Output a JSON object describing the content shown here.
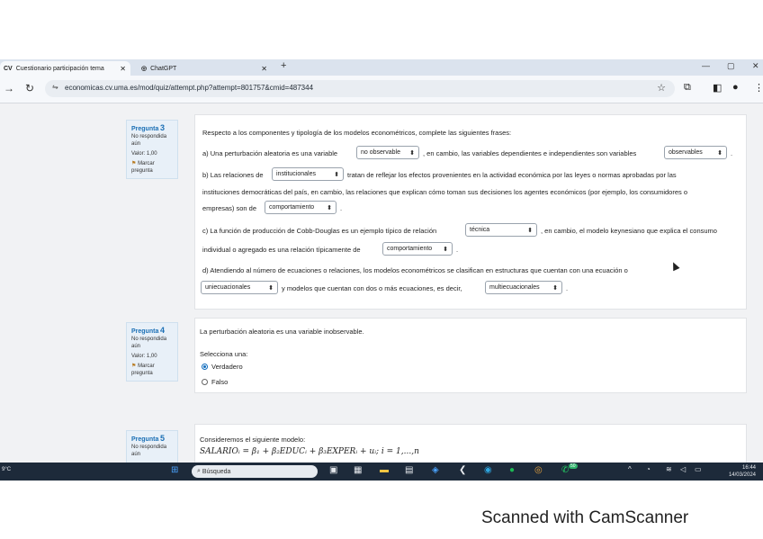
{
  "browser": {
    "tabs": [
      {
        "icon": "CV",
        "label": "Cuestionario participación tema"
      },
      {
        "icon": "◎",
        "label": "ChatGPT"
      }
    ],
    "url": "economicas.cv.uma.es/mod/quiz/attempt.php?attempt=801757&cmid=487344"
  },
  "q3": {
    "title_word": "Pregunta",
    "number": "3",
    "status": "No respondida aún",
    "score": "Valor: 1,00",
    "flag": "Marcar pregunta",
    "intro": "Respecto a los componentes y tipología de los modelos econométricos, complete las siguientes frases:",
    "a1": "a) Una perturbación aleatoria es una variable",
    "a_sel1": "no observable",
    "a2": ", en cambio, las variables dependientes e independientes son variables",
    "a_sel2": "observables",
    "a3": ".",
    "b1": "b) Las relaciones de",
    "b_sel1": "institucionales",
    "b2": "tratan de reflejar los efectos provenientes en la actividad económica por las leyes o normas aprobadas por las",
    "b3": "instituciones democráticas del país, en cambio, las relaciones que explican cómo toman sus decisiones los agentes económicos (por ejemplo, los consumidores o",
    "b4": "empresas) son de",
    "b_sel2": "comportamiento",
    "b5": ".",
    "c1": "c) La función de producción de Cobb-Douglas es un ejemplo típico de relación",
    "c_sel1": "técnica",
    "c2": ", en cambio, el modelo keynesiano que explica el consumo",
    "c3": "individual o agregado es una relación típicamente de",
    "c_sel2": "comportamiento",
    "c4": ".",
    "d1": "d) Atendiendo al número de ecuaciones o relaciones, los modelos econométricos se clasifican en  estructuras que cuentan con una ecuación o",
    "d_sel1": "uniecuacionales",
    "d2": "y modelos que cuentan con dos o más ecuaciones, es decir,",
    "d_sel2": "multiecuacionales",
    "d3": "."
  },
  "q4": {
    "title_word": "Pregunta",
    "number": "4",
    "status": "No respondida aún",
    "score": "Valor: 1,00",
    "flag": "Marcar pregunta",
    "statement": "La perturbación aleatoria es una variable inobservable.",
    "prompt": "Selecciona una:",
    "options": [
      "Verdadero",
      "Falso"
    ],
    "selected": "Verdadero"
  },
  "q5": {
    "title_word": "Pregunta",
    "number": "5",
    "status": "No respondida aún",
    "statement": "Consideremos el siguiente modelo:",
    "formula": "SALARIOᵢ = β₁ + β₂EDUCᵢ + β₃EXPERᵢ + uᵢ; i = 1,...,n"
  },
  "taskbar": {
    "temp": "9°C",
    "search": "Búsqueda",
    "time": "16:44",
    "date": "14/03/2024",
    "badge": "50"
  },
  "watermark": "Scanned with CamScanner",
  "colors": {
    "accent": "#1b6fb5",
    "taskbar": "#1d2a3a",
    "tabbar": "#dbe3ee"
  }
}
